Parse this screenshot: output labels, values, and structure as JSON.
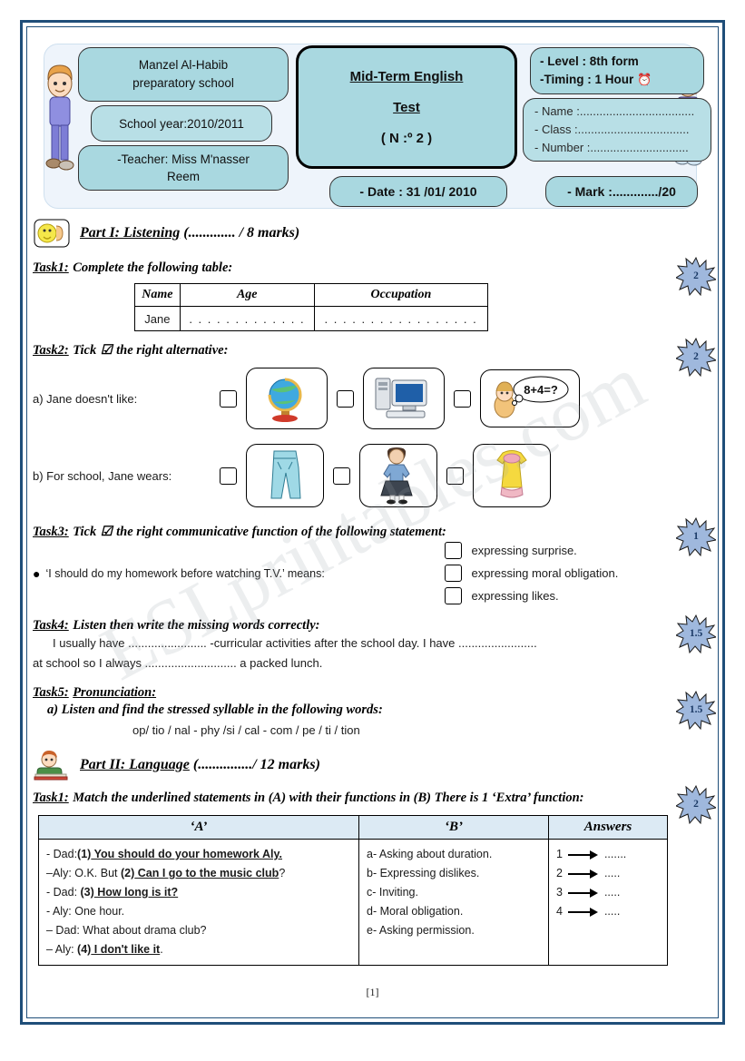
{
  "document": {
    "page_number": "[1]",
    "watermark": "ESLprintables.com",
    "border_color": "#1f4e79",
    "bubble_color": "#a9d8e0",
    "table_header_color": "#dceaf4"
  },
  "header": {
    "school_name_line1": "Manzel Al-Habib",
    "school_name_line2": "preparatory school",
    "school_year": "School year:2010/2011",
    "teacher_line1": "-Teacher: Miss M'nasser",
    "teacher_line2": "Reem",
    "title_line1": "Mid-Term English",
    "title_line2": "Test",
    "title_line3": "( N :º 2 )",
    "level": "- Level : 8th form",
    "timing": "-Timing : 1 Hour",
    "timing_icon": "alarm-clock-icon",
    "name_field": "- Name :...................................",
    "class_field": "- Class :..................................",
    "number_field": "- Number :..............................",
    "date": "- Date : 31 /01/ 2010",
    "mark": "- Mark :............./20",
    "kid_left_icon": "boy-student-illustration",
    "kid_right_icon": "girl-student-illustration"
  },
  "part1": {
    "icon": "listening-ear-icon",
    "heading": "Part I: Listening",
    "heading_marks": "(............. / 8 marks)",
    "task1": {
      "label": "Task1:",
      "instruction": "Complete the following table:",
      "mark": "2",
      "columns": [
        "Name",
        "Age",
        "Occupation"
      ],
      "row": [
        "Jane",
        ". . . . . . . . . . . . .",
        ". . . . . . . . . . . . . . . . ."
      ]
    },
    "task2": {
      "label": "Task2:",
      "instruction_pre": "Tick",
      "tick_glyph": "☑",
      "instruction_post": "the right alternative:",
      "mark": "2",
      "question_a": {
        "prompt": "a) Jane doesn't like:",
        "options": [
          {
            "icon": "globe-icon",
            "checked": false
          },
          {
            "icon": "desktop-computer-icon",
            "checked": false
          },
          {
            "icon": "math-thinking-icon",
            "label": "8+4=?",
            "checked": false
          }
        ]
      },
      "question_b": {
        "prompt": "b) For school, Jane wears:",
        "options": [
          {
            "icon": "jeans-icon",
            "checked": false
          },
          {
            "icon": "school-uniform-girl-icon",
            "checked": false
          },
          {
            "icon": "yellow-dress-icon",
            "checked": false
          }
        ]
      }
    },
    "task3": {
      "label": "Task3:",
      "instruction_pre": "Tick",
      "tick_glyph": "☑",
      "instruction_post": "the right communicative function of the following statement:",
      "mark": "1",
      "statement": "‘I should do my homework before watching T.V.’  means:",
      "options": [
        "expressing surprise.",
        "expressing moral obligation.",
        "expressing likes."
      ]
    },
    "task4": {
      "label": "Task4:",
      "instruction": "Listen then write the missing words correctly:",
      "mark": "1.5",
      "line1": "I usually have ........................ -curricular activities after the school day.  I have ........................",
      "line2": "at school so I always ............................ a packed lunch."
    },
    "task5": {
      "label": "Task5:",
      "instruction": "Pronunciation:",
      "mark": "1.5",
      "sub_a": "a) Listen and find the stressed syllable in the following words:",
      "words": "op/ tio / nal    -    phy /si / cal  -   com / pe / ti / tion"
    }
  },
  "part2": {
    "icon": "reading-boy-icon",
    "heading": "Part II: Language",
    "heading_marks": "(.............../ 12 marks)",
    "task1": {
      "label": "Task1:",
      "instruction": "Match the underlined statements in (A) with their functions in (B)  There is 1 ‘Extra’ function:",
      "mark": "2",
      "columns": [
        "‘A’",
        "‘B’",
        "Answers"
      ],
      "column_a_lines": [
        {
          "pre": "- Dad:",
          "num": "(1)",
          "underlined": " You should do your homework Aly.",
          "post": ""
        },
        {
          "pre": "–Aly: O.K. But ",
          "num": "(2)",
          "underlined": " Can I go to the music club",
          "post": "?"
        },
        {
          "pre": "- Dad: ",
          "num": "(3)",
          "underlined": " How long is it?",
          "post": ""
        },
        {
          "pre": "- Aly: One hour.",
          "num": "",
          "underlined": "",
          "post": ""
        },
        {
          "pre": "– Dad: What about drama club?",
          "num": "",
          "underlined": "",
          "post": ""
        },
        {
          "pre": "– Aly: ",
          "num": "(4)",
          "underlined": " I don't like it",
          "post": "."
        }
      ],
      "column_b_lines": [
        "a- Asking about duration.",
        "b- Expressing dislikes.",
        "c- Inviting.",
        "d- Moral obligation.",
        "e- Asking permission."
      ],
      "answers": [
        {
          "num": "1",
          "dots": "......."
        },
        {
          "num": "2",
          "dots": "....."
        },
        {
          "num": "3",
          "dots": "....."
        },
        {
          "num": "4",
          "dots": "....."
        }
      ]
    }
  }
}
